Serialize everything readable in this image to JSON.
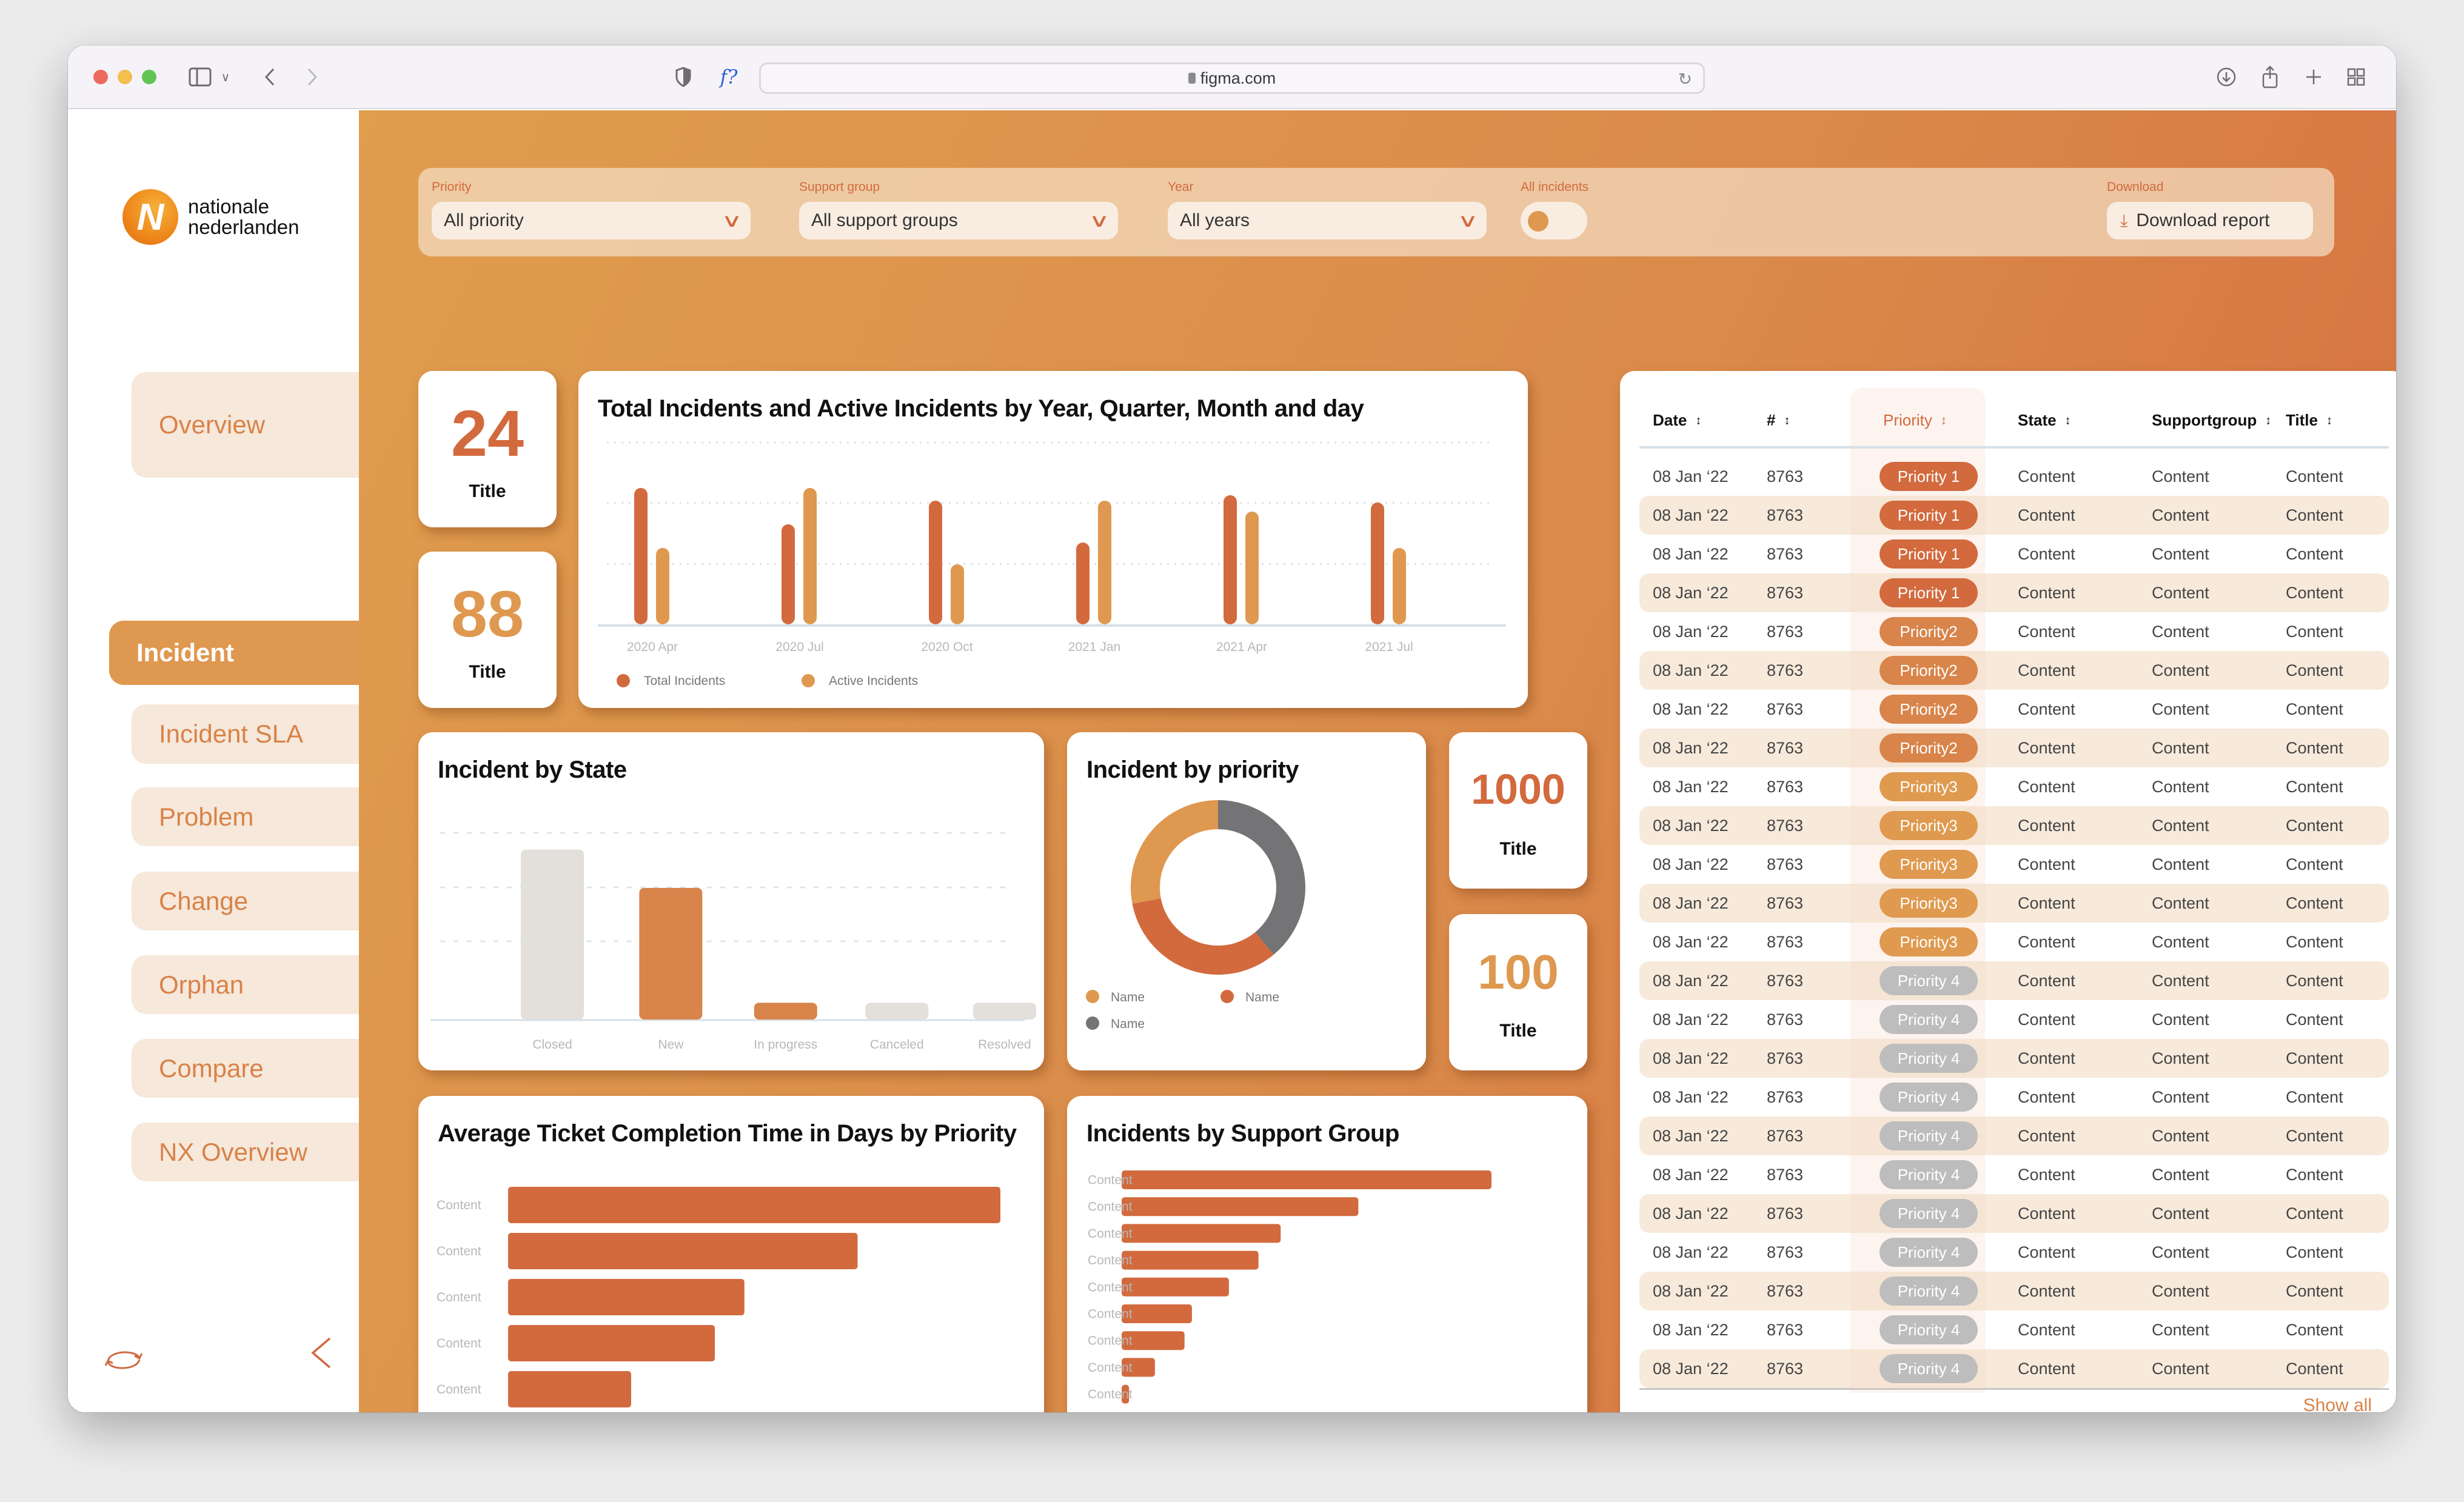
{
  "browser": {
    "url": "figma.com",
    "icons": [
      "sidebar-toggle-icon",
      "chevron-down-icon",
      "back-icon",
      "forward-icon",
      "shield-icon",
      "extension-icon",
      "lock-icon",
      "reload-icon",
      "download-icon",
      "share-icon",
      "new-tab-icon",
      "tab-overview-icon"
    ],
    "extension_glyph": "f?"
  },
  "brand": {
    "line1": "nationale",
    "line2": "nederlanden",
    "mark": "N"
  },
  "sidebar": {
    "items": [
      {
        "label": "Overview",
        "active": false
      },
      {
        "label": "Incident",
        "active": true
      },
      {
        "label": "Incident SLA",
        "active": false
      },
      {
        "label": "Problem",
        "active": false
      },
      {
        "label": "Change",
        "active": false
      },
      {
        "label": "Orphan",
        "active": false
      },
      {
        "label": "Compare",
        "active": false
      },
      {
        "label": "NX Overview",
        "active": false
      }
    ],
    "bottom_icons": [
      "refresh-icon",
      "collapse-icon"
    ]
  },
  "filters": {
    "priority": {
      "label": "Priority",
      "value": "All priority"
    },
    "support_group": {
      "label": "Support group",
      "value": "All support groups"
    },
    "year": {
      "label": "Year",
      "value": "All years"
    },
    "all_incidents": {
      "label": "All incidents",
      "on": false
    },
    "download": {
      "label": "Download",
      "button": "Download report"
    }
  },
  "kpis": [
    {
      "value": "24",
      "title": "Title",
      "color": "#d26a3e"
    },
    {
      "value": "88",
      "title": "Title",
      "color": "#df984f"
    },
    {
      "value": "1000",
      "title": "Title",
      "color": "#d26a3e"
    },
    {
      "value": "100",
      "title": "Title",
      "color": "#df984f"
    }
  ],
  "colors": {
    "accent_dark": "#d26a3e",
    "accent_light": "#df984f",
    "accent_mid": "#d8844a",
    "gray_bar": "#e3dfdb",
    "gray_pill": "#bdbdbd",
    "donut_gray": "#747476"
  },
  "chart_data": [
    {
      "id": "incidents-timeline",
      "type": "bar",
      "title": "Total Incidents and Active Incidents by Year, Quarter, Month and day",
      "categories": [
        "2020 Apr",
        "2020 Jul",
        "2020 Oct",
        "2021 Jan",
        "2021 Apr",
        "2021 Jul"
      ],
      "series": [
        {
          "name": "Total Incidents",
          "values": [
            75,
            55,
            68,
            45,
            71,
            67
          ]
        },
        {
          "name": "Active Incidents",
          "values": [
            42,
            75,
            33,
            68,
            62,
            42
          ]
        }
      ],
      "ylim": [
        0,
        100
      ],
      "grid": true,
      "legend": "bottom-left",
      "xlabel": "",
      "ylabel": ""
    },
    {
      "id": "incident-by-state",
      "type": "bar",
      "title": "Incident by State",
      "categories": [
        "Closed",
        "New",
        "In progress",
        "Canceled",
        "Resolved"
      ],
      "values": [
        71,
        55,
        7,
        7,
        7
      ],
      "highlight": [
        false,
        true,
        true,
        false,
        false
      ],
      "ylim": [
        0,
        78
      ],
      "grid": true,
      "xlabel": "",
      "ylabel": ""
    },
    {
      "id": "incident-by-priority",
      "type": "pie",
      "title": "Incident by priority",
      "slices": [
        {
          "name": "Name",
          "value": 39,
          "color": "#747476"
        },
        {
          "name": "Name",
          "value": 33,
          "color": "#d26a3e"
        },
        {
          "name": "Name",
          "value": 28,
          "color": "#df984f"
        }
      ],
      "legend_order": [
        {
          "name": "Name",
          "color": "#df984f"
        },
        {
          "name": "Name",
          "color": "#d26a3e"
        },
        {
          "name": "Name",
          "color": "#747476"
        }
      ],
      "donut": true,
      "legend": "bottom"
    },
    {
      "id": "avg-completion",
      "type": "bar",
      "orientation": "horizontal",
      "title": "Average Ticket Completion Time in Days by Priority",
      "categories": [
        "Content",
        "Content",
        "Content",
        "Content",
        "Content"
      ],
      "values": [
        100,
        71,
        48,
        42,
        25
      ],
      "xlim": [
        0,
        100
      ]
    },
    {
      "id": "by-support-group",
      "type": "bar",
      "orientation": "horizontal",
      "title": "Incidents by Support Group",
      "categories": [
        "Content",
        "Content",
        "Content",
        "Content",
        "Content",
        "Content",
        "Content",
        "Content",
        "Content"
      ],
      "values": [
        100,
        64,
        43,
        37,
        29,
        19,
        17,
        9,
        2
      ],
      "xlim": [
        0,
        100
      ]
    }
  ],
  "table": {
    "columns": [
      "Date",
      "#",
      "Priority",
      "State",
      "Supportgroup",
      "Title"
    ],
    "active_sort_column": "Priority",
    "rows": [
      [
        "08 Jan ‘22",
        "8763",
        "Priority 1",
        "Content",
        "Content",
        "Content"
      ],
      [
        "08 Jan ‘22",
        "8763",
        "Priority 1",
        "Content",
        "Content",
        "Content"
      ],
      [
        "08 Jan ‘22",
        "8763",
        "Priority 1",
        "Content",
        "Content",
        "Content"
      ],
      [
        "08 Jan ‘22",
        "8763",
        "Priority 1",
        "Content",
        "Content",
        "Content"
      ],
      [
        "08 Jan ‘22",
        "8763",
        "Priority2",
        "Content",
        "Content",
        "Content"
      ],
      [
        "08 Jan ‘22",
        "8763",
        "Priority2",
        "Content",
        "Content",
        "Content"
      ],
      [
        "08 Jan ‘22",
        "8763",
        "Priority2",
        "Content",
        "Content",
        "Content"
      ],
      [
        "08 Jan ‘22",
        "8763",
        "Priority2",
        "Content",
        "Content",
        "Content"
      ],
      [
        "08 Jan ‘22",
        "8763",
        "Priority3",
        "Content",
        "Content",
        "Content"
      ],
      [
        "08 Jan ‘22",
        "8763",
        "Priority3",
        "Content",
        "Content",
        "Content"
      ],
      [
        "08 Jan ‘22",
        "8763",
        "Priority3",
        "Content",
        "Content",
        "Content"
      ],
      [
        "08 Jan ‘22",
        "8763",
        "Priority3",
        "Content",
        "Content",
        "Content"
      ],
      [
        "08 Jan ‘22",
        "8763",
        "Priority3",
        "Content",
        "Content",
        "Content"
      ],
      [
        "08 Jan ‘22",
        "8763",
        "Priority 4",
        "Content",
        "Content",
        "Content"
      ],
      [
        "08 Jan ‘22",
        "8763",
        "Priority 4",
        "Content",
        "Content",
        "Content"
      ],
      [
        "08 Jan ‘22",
        "8763",
        "Priority 4",
        "Content",
        "Content",
        "Content"
      ],
      [
        "08 Jan ‘22",
        "8763",
        "Priority 4",
        "Content",
        "Content",
        "Content"
      ],
      [
        "08 Jan ‘22",
        "8763",
        "Priority 4",
        "Content",
        "Content",
        "Content"
      ],
      [
        "08 Jan ‘22",
        "8763",
        "Priority 4",
        "Content",
        "Content",
        "Content"
      ],
      [
        "08 Jan ‘22",
        "8763",
        "Priority 4",
        "Content",
        "Content",
        "Content"
      ],
      [
        "08 Jan ‘22",
        "8763",
        "Priority 4",
        "Content",
        "Content",
        "Content"
      ],
      [
        "08 Jan ‘22",
        "8763",
        "Priority 4",
        "Content",
        "Content",
        "Content"
      ],
      [
        "08 Jan ‘22",
        "8763",
        "Priority 4",
        "Content",
        "Content",
        "Content"
      ],
      [
        "08 Jan ‘22",
        "8763",
        "Priority 4",
        "Content",
        "Content",
        "Content"
      ]
    ],
    "priority_colors": {
      "Priority 1": "#d26a3e",
      "Priority2": "#d8844a",
      "Priority3": "#df9a4f",
      "Priority 4": "#bdbdbd"
    },
    "show_all": "Show all"
  }
}
